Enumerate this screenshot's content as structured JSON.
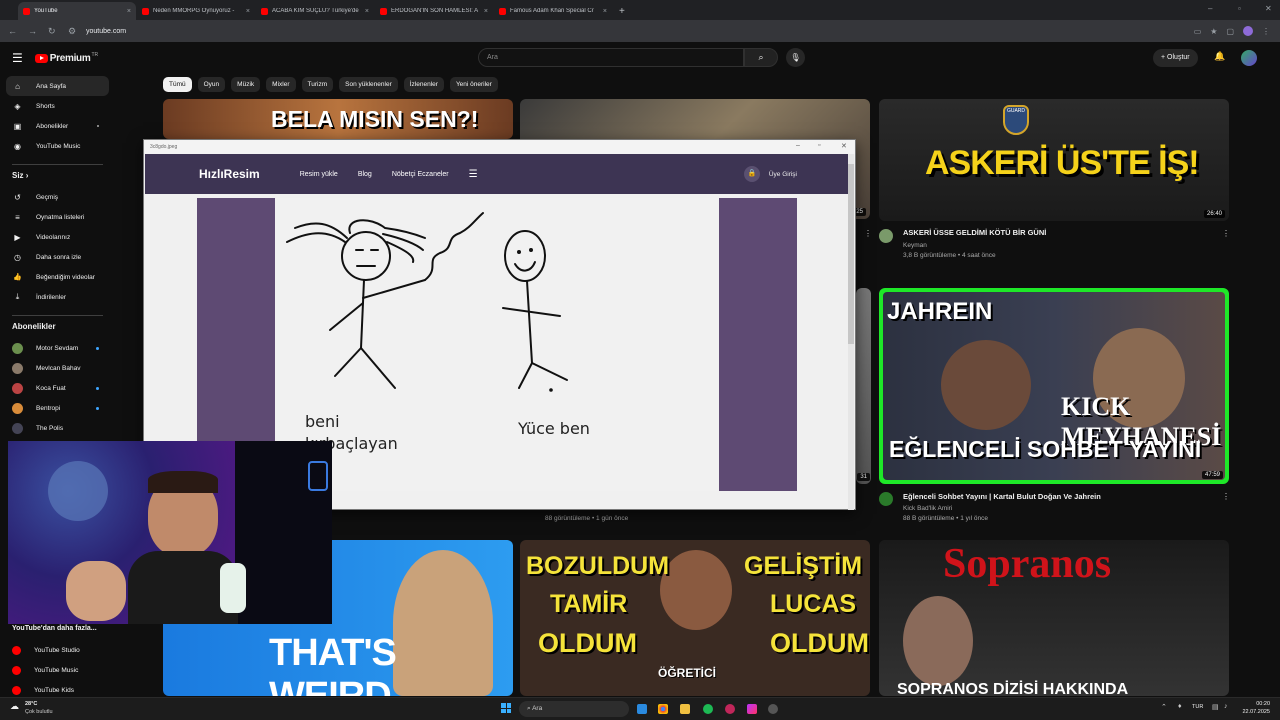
{
  "browser": {
    "tabs": [
      {
        "label": "YouTube",
        "active": true
      },
      {
        "label": "Neden MMORPG Oynuyoruz - ",
        "active": false
      },
      {
        "label": "ACABA KİM SUÇLU? Türkiye'de",
        "active": false
      },
      {
        "label": "ERDOĞAN'IN SON HAMLESİ: A",
        "active": false
      },
      {
        "label": "Famous Adam Khan Special Cr",
        "active": false
      }
    ],
    "new_tab": "+",
    "close_glyph": "×",
    "url": "youtube.com"
  },
  "masthead": {
    "brand": "Premium",
    "brand_suffix": "TR",
    "search_placeholder": "Ara",
    "create_label": "Oluştur"
  },
  "chips": [
    "Tümü",
    "Oyun",
    "Müzik",
    "Mixler",
    "Turizm",
    "Son yüklenenler",
    "İzlenenler",
    "Yeni öneriler"
  ],
  "sidebar": {
    "main": [
      {
        "label": "Ana Sayfa",
        "icon": "home-icon",
        "glyph": "⌂"
      },
      {
        "label": "Shorts",
        "icon": "shorts-icon",
        "glyph": "◈"
      },
      {
        "label": "Abonelikler",
        "icon": "subscriptions-icon",
        "glyph": "▣"
      },
      {
        "label": "YouTube Music",
        "icon": "music-icon",
        "glyph": "◉"
      }
    ],
    "you_header": "Siz",
    "you": [
      {
        "label": "Geçmiş",
        "icon": "history-icon",
        "glyph": "↺"
      },
      {
        "label": "Oynatma listeleri",
        "icon": "playlists-icon",
        "glyph": "≡"
      },
      {
        "label": "Videolarınız",
        "icon": "your-videos-icon",
        "glyph": "▶"
      },
      {
        "label": "Daha sonra izle",
        "icon": "watch-later-icon",
        "glyph": "◷"
      },
      {
        "label": "Beğendiğim videolar",
        "icon": "liked-icon",
        "glyph": "👍"
      },
      {
        "label": "İndirilenler",
        "icon": "downloads-icon",
        "glyph": "⤓"
      }
    ],
    "subs_header": "Abonelikler",
    "subs": [
      {
        "label": "Motor Sevdam",
        "color": "#6b8f4e"
      },
      {
        "label": "Mevlcan Bahav",
        "color": "#8a7a6a"
      },
      {
        "label": "Koca Fuat",
        "color": "#b44"
      },
      {
        "label": "Bentropi",
        "color": "#d98c3a"
      },
      {
        "label": "The Polis",
        "color": "#445"
      }
    ],
    "more_header": "YouTube'dan daha fazla...",
    "more": [
      {
        "label": "YouTube Studio"
      },
      {
        "label": "YouTube Music"
      },
      {
        "label": "YouTube Kids"
      }
    ]
  },
  "videos": {
    "v1": {
      "thumb_text": "BELA MISIN SEN?!"
    },
    "v3": {
      "thumb_text": "ASKERİ ÜS'TE İŞ!",
      "badge": "GUARD",
      "duration": "26:40",
      "title": "ASKERİ ÜSSE GELDİMİ KÖTÜ BİR GÜNİ",
      "channel": "Keyman",
      "meta": "3,8 B görüntüleme • 4 saat önce"
    },
    "v6": {
      "thumb_top": "JAHREIN",
      "thumb_mid": "KICK MEYHANESİ",
      "thumb_bottom": "EĞLENCELİ SOHBET YAYINI",
      "duration": "47:59",
      "title": "Eğlenceli Sohbet Yayını | Kartal Bulut Doğan Ve Jahrein",
      "channel": "Kick Bad'lik Amiri",
      "meta": "88 B görüntüleme • 1 yıl önce"
    },
    "v5": {
      "meta": "88 görüntüleme • 1 gün önce"
    },
    "v2_duration": "25",
    "v5_duration": "31",
    "v7": {
      "thumb_text": "THAT'S WEIRD"
    },
    "v8": {
      "left1": "BOZULDUM",
      "left2": "TAMİR",
      "left3": "OLDUM",
      "right1": "GELİŞTİM",
      "right2": "LUCAS",
      "right3": "OLDUM",
      "center": "ÖĞRETİCİ"
    },
    "v9": {
      "thumb_text": "Sopranos",
      "thumb_bottom": "SOPRANOS DİZİSİ HAKKINDA"
    }
  },
  "popup": {
    "window_title": "3c8gdo.jpeg",
    "site_logo": "HızlıResim",
    "nav": [
      "Resim yükle",
      "Blog",
      "Nöbetçi Eczaneler"
    ],
    "login": "Üye Girişi",
    "drawing": {
      "left_caption": "beni kırbaçlayan",
      "right_caption": "Yüce ben"
    }
  },
  "taskbar": {
    "weather_temp": "28°C",
    "weather_desc": "Çok bulutlu",
    "search_placeholder": "Ara",
    "lang": "TUR",
    "time": "00:20",
    "date": "22.07.2025"
  }
}
